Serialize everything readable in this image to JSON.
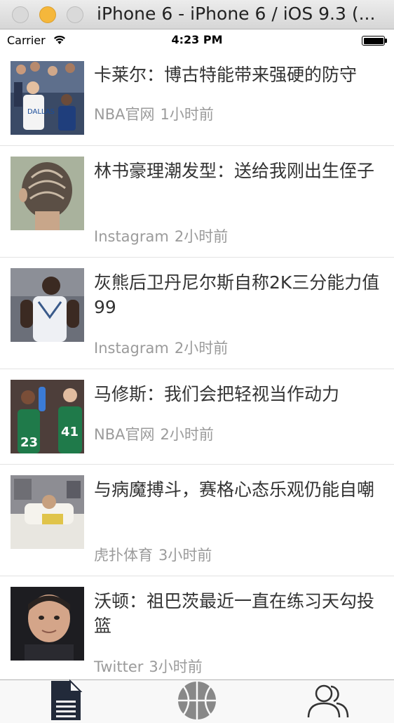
{
  "window": {
    "title": "iPhone 6 - iPhone 6 / iOS 9.3 (..."
  },
  "status_bar": {
    "carrier": "Carrier",
    "time": "4:23 PM",
    "battery_level": 1.0
  },
  "news": [
    {
      "title": "卡莱尔：博古特能带来强硬的防守",
      "source": "NBA官网",
      "time": "1小时前",
      "thumb": "basketball-player-dallas-white"
    },
    {
      "title": "林书豪理潮发型：送给我刚出生侄子",
      "source": "Instagram",
      "time": "2小时前",
      "thumb": "haircut-back-of-head"
    },
    {
      "title": "灰熊后卫丹尼尔斯自称2K三分能力值99",
      "source": "Instagram",
      "time": "2小时前",
      "thumb": "basketball-player-memphis-white"
    },
    {
      "title": "马修斯：我们会把轻视当作动力",
      "source": "NBA官网",
      "time": "2小时前",
      "thumb": "basketball-players-green"
    },
    {
      "title": "与病魔搏斗，赛格心态乐观仍能自嘲",
      "source": "虎扑体育",
      "time": "3小时前",
      "thumb": "hospital-bed"
    },
    {
      "title": "沃顿：祖巴茨最近一直在练习天勾投篮",
      "source": "Twitter",
      "time": "3小时前",
      "thumb": "portrait-young-man"
    }
  ],
  "tab_bar": {
    "tabs": [
      {
        "icon": "document-icon",
        "selected": true
      },
      {
        "icon": "basketball-icon",
        "selected": false
      },
      {
        "icon": "users-icon",
        "selected": false
      }
    ]
  },
  "colors": {
    "title_text": "#333333",
    "meta_text": "#9b9b9b",
    "separator": "#e3e3e3",
    "tab_selected": "#222a3a",
    "tab_unselected": "#888888"
  }
}
